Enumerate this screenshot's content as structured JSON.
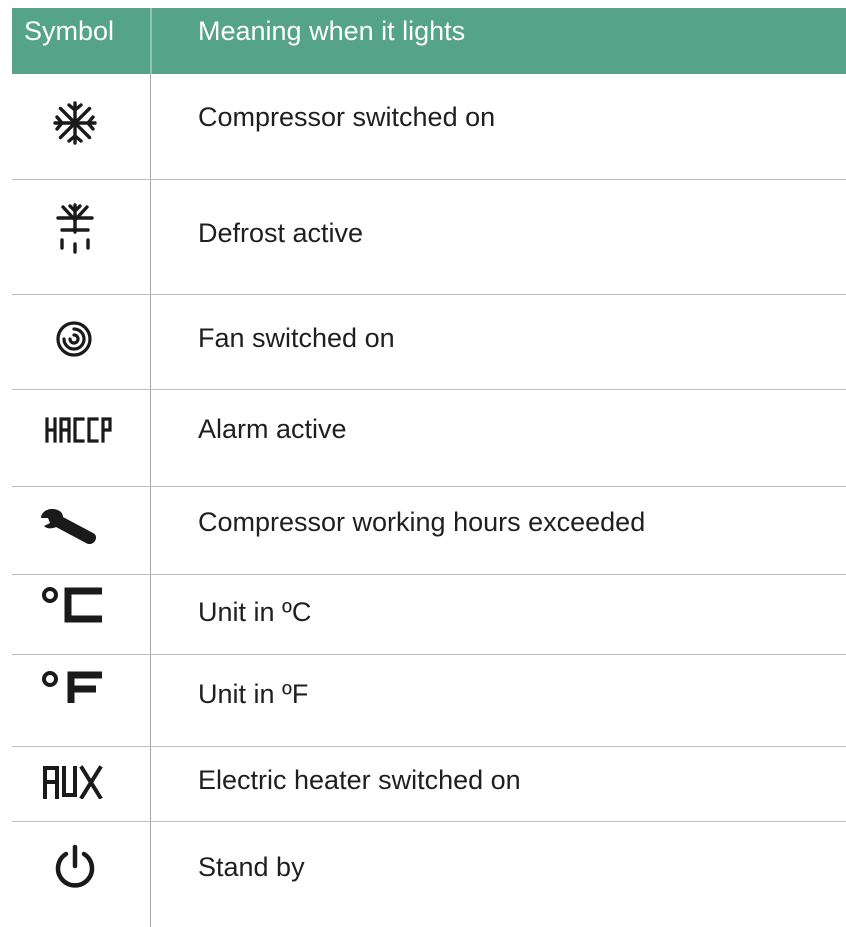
{
  "table": {
    "header": {
      "symbol": "Symbol",
      "meaning": "Meaning when it lights"
    },
    "rows": [
      {
        "icon": "snowflake-icon",
        "meaning": "Compressor switched on"
      },
      {
        "icon": "defrost-icon",
        "meaning": "Defrost active"
      },
      {
        "icon": "fan-icon",
        "meaning": "Fan switched on"
      },
      {
        "icon": "haccp-icon",
        "icon_text": "HACCP",
        "meaning": "Alarm active"
      },
      {
        "icon": "wrench-icon",
        "meaning": "Compressor working hours exceeded"
      },
      {
        "icon": "celsius-icon",
        "icon_text": "°C",
        "meaning": "Unit in ºC"
      },
      {
        "icon": "fahrenheit-icon",
        "icon_text": "°F",
        "meaning": "Unit in ºF"
      },
      {
        "icon": "aux-icon",
        "icon_text": "AUX",
        "meaning": "Electric heater switched on"
      },
      {
        "icon": "power-icon",
        "meaning": "Stand by"
      }
    ]
  },
  "colors": {
    "header_background": "#55a388",
    "header_text": "#ffffff",
    "body_text": "#1f1f1f",
    "grid_lines": "#bdbdbd"
  }
}
